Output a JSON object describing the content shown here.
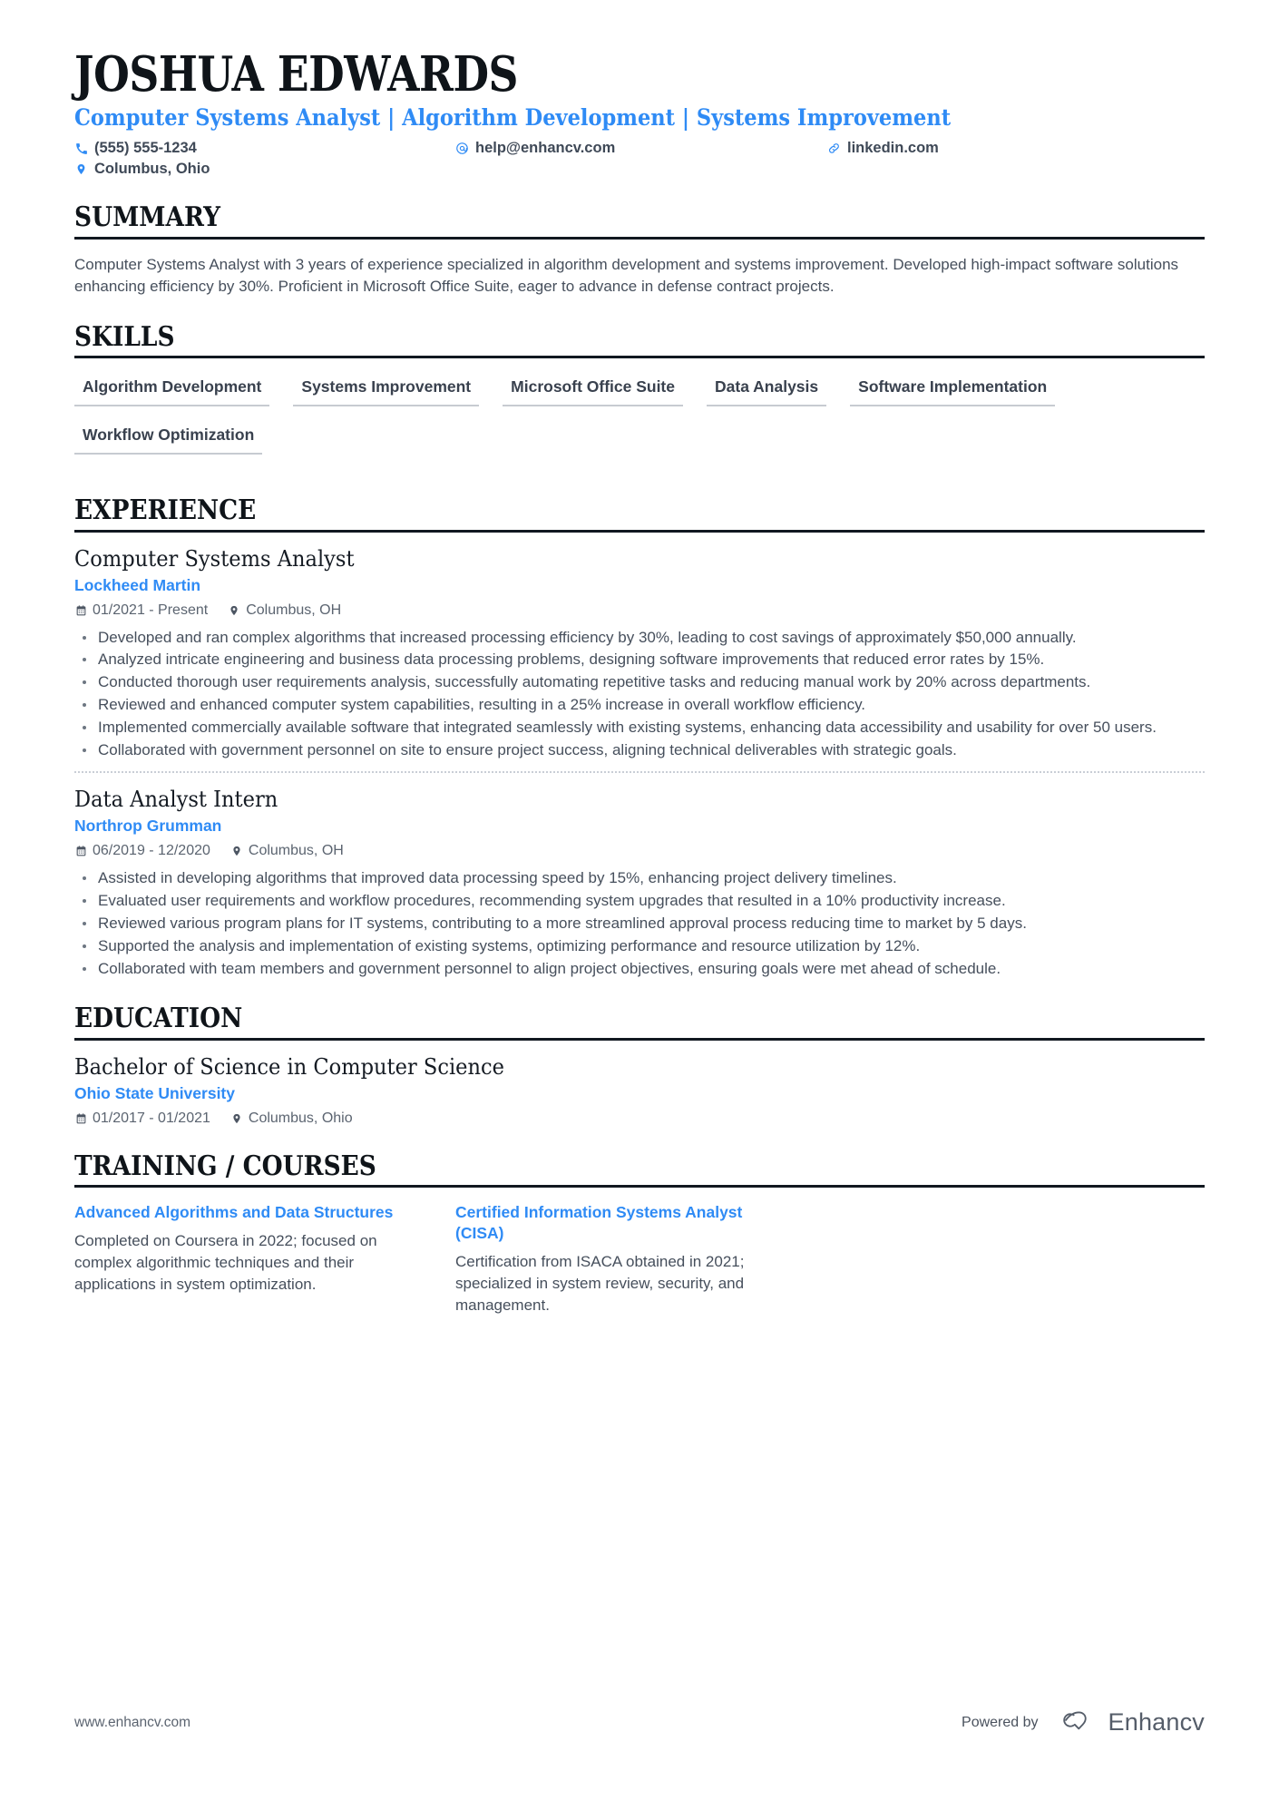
{
  "header": {
    "name": "JOSHUA EDWARDS",
    "headline": "Computer Systems Analyst | Algorithm Development | Systems Improvement",
    "contacts": [
      {
        "icon": "phone-icon",
        "text": "(555) 555-1234"
      },
      {
        "icon": "email-icon",
        "text": "help@enhancv.com"
      },
      {
        "icon": "link-icon",
        "text": "linkedin.com"
      },
      {
        "icon": "location-icon",
        "text": "Columbus, Ohio"
      }
    ]
  },
  "summary": {
    "title": "SUMMARY",
    "text": "Computer Systems Analyst with 3 years of experience specialized in algorithm development and systems improvement. Developed high-impact software solutions enhancing efficiency by 30%. Proficient in Microsoft Office Suite, eager to advance in defense contract projects."
  },
  "skills": {
    "title": "SKILLS",
    "items": [
      "Algorithm Development",
      "Systems Improvement",
      "Microsoft Office Suite",
      "Data Analysis",
      "Software Implementation",
      "Workflow Optimization"
    ]
  },
  "experience": {
    "title": "EXPERIENCE",
    "entries": [
      {
        "title": "Computer Systems Analyst",
        "org": "Lockheed Martin",
        "dates": "01/2021 - Present",
        "location": "Columbus, OH",
        "bullets": [
          "Developed and ran complex algorithms that increased processing efficiency by 30%, leading to cost savings of approximately $50,000 annually.",
          "Analyzed intricate engineering and business data processing problems, designing software improvements that reduced error rates by 15%.",
          "Conducted thorough user requirements analysis, successfully automating repetitive tasks and reducing manual work by 20% across departments.",
          "Reviewed and enhanced computer system capabilities, resulting in a 25% increase in overall workflow efficiency.",
          "Implemented commercially available software that integrated seamlessly with existing systems, enhancing data accessibility and usability for over 50 users.",
          "Collaborated with government personnel on site to ensure project success, aligning technical deliverables with strategic goals."
        ]
      },
      {
        "title": "Data Analyst Intern",
        "org": "Northrop Grumman",
        "dates": "06/2019 - 12/2020",
        "location": "Columbus, OH",
        "bullets": [
          "Assisted in developing algorithms that improved data processing speed by 15%, enhancing project delivery timelines.",
          "Evaluated user requirements and workflow procedures, recommending system upgrades that resulted in a 10% productivity increase.",
          "Reviewed various program plans for IT systems, contributing to a more streamlined approval process reducing time to market by 5 days.",
          "Supported the analysis and implementation of existing systems, optimizing performance and resource utilization by 12%.",
          "Collaborated with team members and government personnel to align project objectives, ensuring goals were met ahead of schedule."
        ]
      }
    ]
  },
  "education": {
    "title": "EDUCATION",
    "entries": [
      {
        "title": "Bachelor of Science in Computer Science",
        "org": "Ohio State University",
        "dates": "01/2017 - 01/2021",
        "location": "Columbus, Ohio"
      }
    ]
  },
  "training": {
    "title": "TRAINING / COURSES",
    "courses": [
      {
        "title": "Advanced Algorithms and Data Structures",
        "desc": "Completed on Coursera in 2022; focused on complex algorithmic techniques and their applications in system optimization."
      },
      {
        "title": "Certified Information Systems Analyst (CISA)",
        "desc": "Certification from ISACA obtained in 2021; specialized in system review, security, and management."
      }
    ]
  },
  "footer": {
    "url": "www.enhancv.com",
    "powered_by": "Powered by",
    "brand": "Enhancv"
  },
  "colors": {
    "accent": "#2f8bf5",
    "text": "#464f5c",
    "heading": "#0f1419",
    "rule": "#111820",
    "skill_underline": "#c7cbd1"
  }
}
